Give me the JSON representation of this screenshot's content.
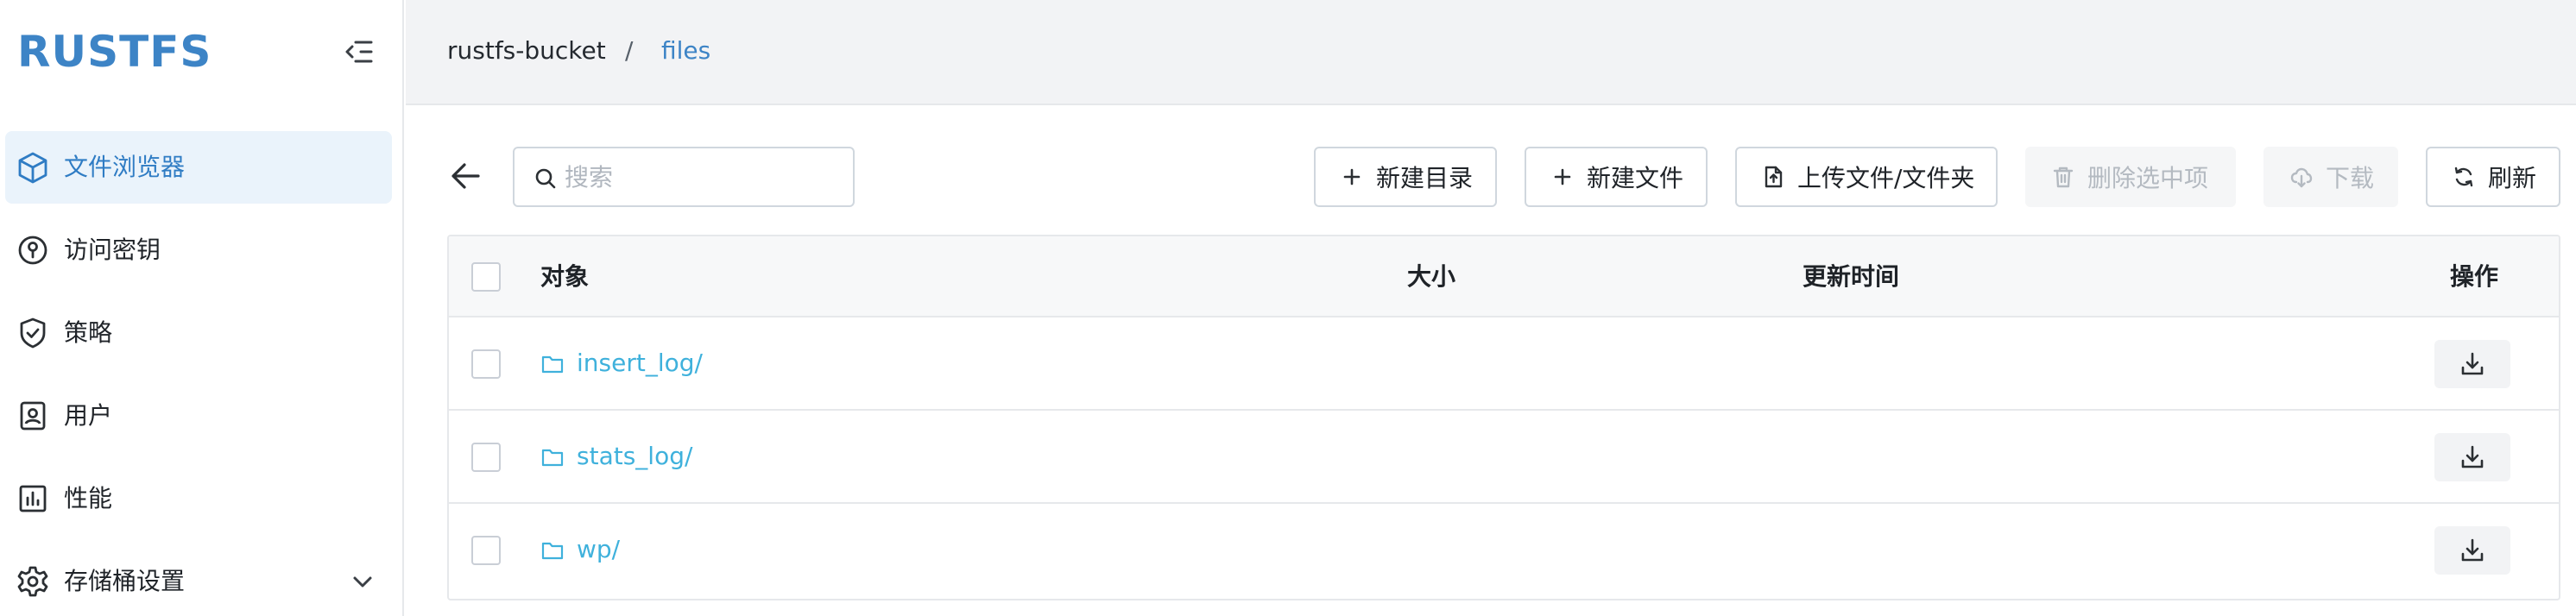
{
  "app": {
    "logo": "RUSTFS"
  },
  "sidebar": {
    "items": [
      {
        "label": "文件浏览器",
        "icon": "cube-icon",
        "active": true
      },
      {
        "label": "访问密钥",
        "icon": "key-icon"
      },
      {
        "label": "策略",
        "icon": "shield-check-icon"
      },
      {
        "label": "用户",
        "icon": "user-badge-icon"
      },
      {
        "label": "性能",
        "icon": "bar-chart-icon"
      },
      {
        "label": "存储桶设置",
        "icon": "gear-icon",
        "expandable": true
      }
    ]
  },
  "breadcrumb": {
    "bucket": "rustfs-bucket",
    "separator": "/",
    "folder": "files"
  },
  "toolbar": {
    "search_placeholder": "搜索",
    "new_dir": "新建目录",
    "new_file": "新建文件",
    "upload": "上传文件/文件夹",
    "delete_selected": "删除选中项",
    "download": "下载",
    "refresh": "刷新"
  },
  "table": {
    "headers": {
      "object": "对象",
      "size": "大小",
      "updated": "更新时间",
      "actions": "操作"
    },
    "rows": [
      {
        "name": "insert_log/",
        "size": "",
        "updated": ""
      },
      {
        "name": "stats_log/",
        "size": "",
        "updated": ""
      },
      {
        "name": "wp/",
        "size": "",
        "updated": ""
      }
    ]
  },
  "colors": {
    "accent": "#3d84c6",
    "link": "#3fb1dc",
    "active_bg": "#eaf3fb"
  }
}
